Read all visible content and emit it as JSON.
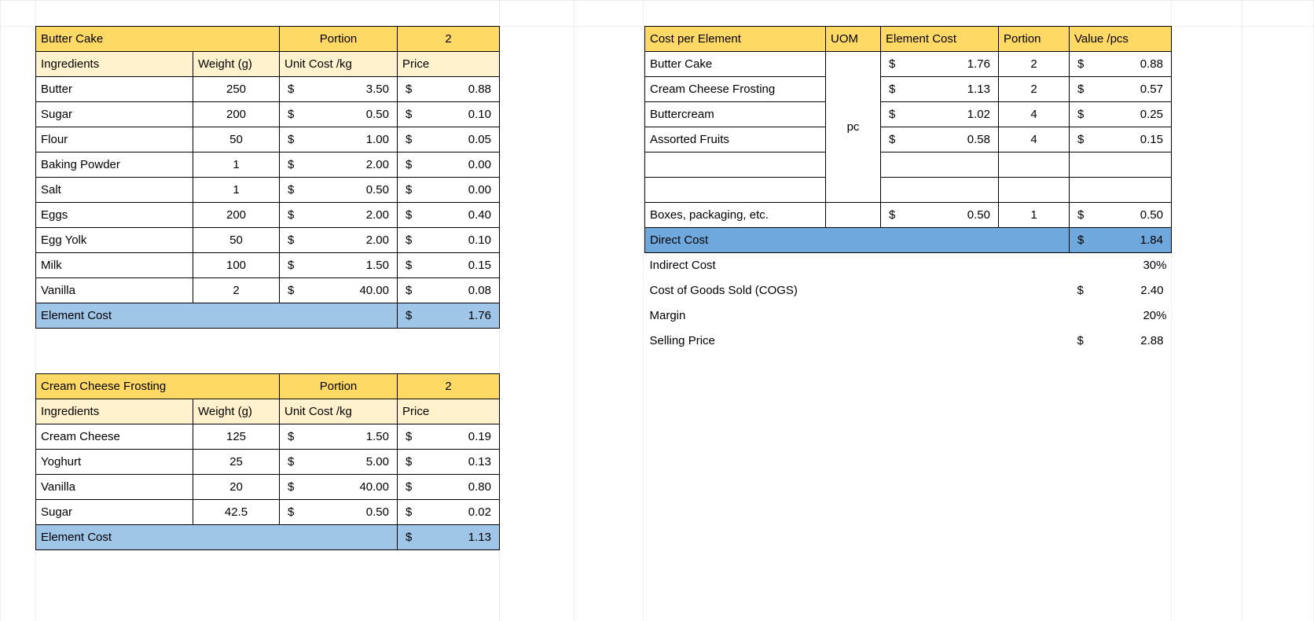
{
  "recipe1": {
    "title": "Butter Cake",
    "portion_label": "Portion",
    "portion_value": "2",
    "cols": {
      "ing": "Ingredients",
      "wt": "Weight (g)",
      "uc": "Unit Cost /kg",
      "price": "Price"
    },
    "rows": [
      {
        "name": "Butter",
        "wt": "250",
        "uc": "3.50",
        "price": "0.88"
      },
      {
        "name": "Sugar",
        "wt": "200",
        "uc": "0.50",
        "price": "0.10"
      },
      {
        "name": "Flour",
        "wt": "50",
        "uc": "1.00",
        "price": "0.05"
      },
      {
        "name": "Baking Powder",
        "wt": "1",
        "uc": "2.00",
        "price": "0.00"
      },
      {
        "name": "Salt",
        "wt": "1",
        "uc": "0.50",
        "price": "0.00"
      },
      {
        "name": "Eggs",
        "wt": "200",
        "uc": "2.00",
        "price": "0.40"
      },
      {
        "name": "Egg Yolk",
        "wt": "50",
        "uc": "2.00",
        "price": "0.10"
      },
      {
        "name": "Milk",
        "wt": "100",
        "uc": "1.50",
        "price": "0.15"
      },
      {
        "name": "Vanilla",
        "wt": "2",
        "uc": "40.00",
        "price": "0.08"
      }
    ],
    "total_label": "Element Cost",
    "total": "1.76"
  },
  "recipe2": {
    "title": "Cream Cheese Frosting",
    "portion_label": "Portion",
    "portion_value": "2",
    "cols": {
      "ing": "Ingredients",
      "wt": "Weight (g)",
      "uc": "Unit Cost /kg",
      "price": "Price"
    },
    "rows": [
      {
        "name": "Cream Cheese",
        "wt": "125",
        "uc": "1.50",
        "price": "0.19"
      },
      {
        "name": "Yoghurt",
        "wt": "25",
        "uc": "5.00",
        "price": "0.13"
      },
      {
        "name": "Vanilla",
        "wt": "20",
        "uc": "40.00",
        "price": "0.80"
      },
      {
        "name": "Sugar",
        "wt": "42.5",
        "uc": "0.50",
        "price": "0.02"
      }
    ],
    "total_label": "Element Cost",
    "total": "1.13"
  },
  "summary": {
    "header": {
      "cpe": "Cost per Element",
      "uom": "UOM",
      "ec": "Element Cost",
      "portion": "Portion",
      "vp": "Value /pcs"
    },
    "uom_value": "pc",
    "elements": [
      {
        "name": "Butter Cake",
        "ec": "1.76",
        "portion": "2",
        "vp": "0.88"
      },
      {
        "name": "Cream Cheese Frosting",
        "ec": "1.13",
        "portion": "2",
        "vp": "0.57"
      },
      {
        "name": "Buttercream",
        "ec": "1.02",
        "portion": "4",
        "vp": "0.25"
      },
      {
        "name": "Assorted Fruits",
        "ec": "0.58",
        "portion": "4",
        "vp": "0.15"
      }
    ],
    "packaging": {
      "name": "Boxes, packaging, etc.",
      "ec": "0.50",
      "portion": "1",
      "vp": "0.50"
    },
    "direct_cost": {
      "label": "Direct Cost",
      "value": "1.84"
    },
    "indirect": {
      "label": "Indirect Cost",
      "value": "30%"
    },
    "cogs": {
      "label": "Cost of Goods Sold (COGS)",
      "value": "2.40"
    },
    "margin": {
      "label": "Margin",
      "value": "20%"
    },
    "selling": {
      "label": "Selling Price",
      "value": "2.88"
    }
  },
  "currency": "$"
}
